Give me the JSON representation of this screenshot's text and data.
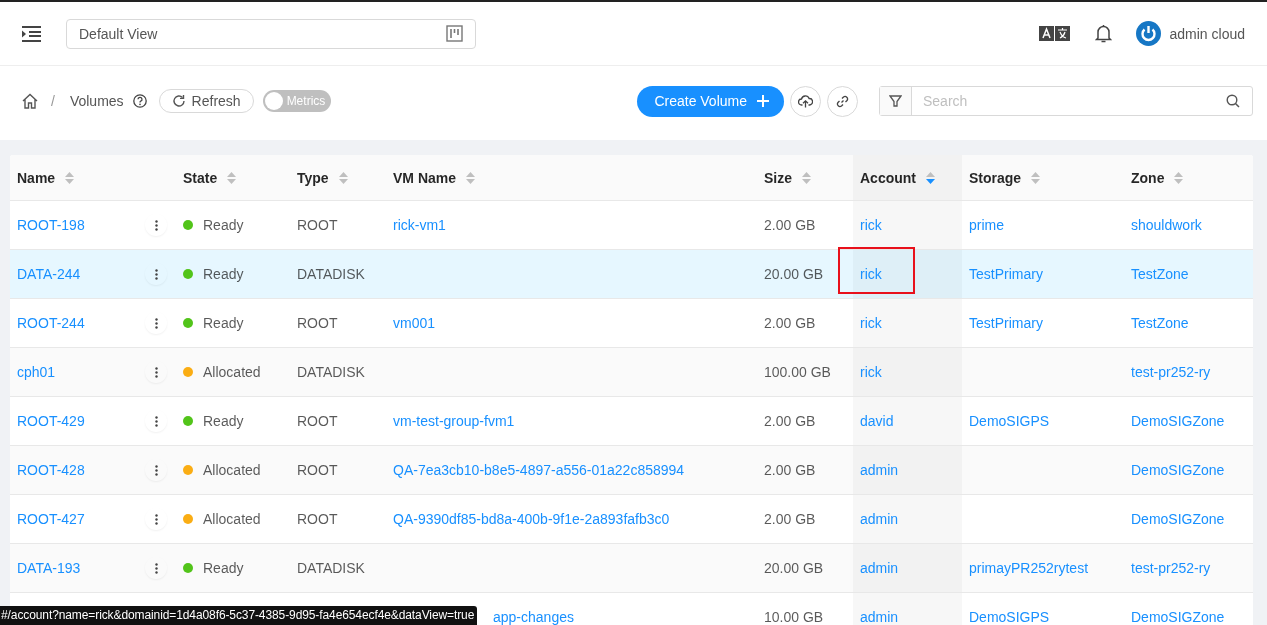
{
  "header": {
    "view_selector": {
      "value": "Default View"
    },
    "user": {
      "name": "admin cloud"
    }
  },
  "breadcrumb": {
    "separator": "/",
    "page": "Volumes"
  },
  "toolbar": {
    "refresh": "Refresh",
    "metrics": {
      "label": "Metrics",
      "on": false
    },
    "create": "Create Volume",
    "search": {
      "placeholder": "Search"
    }
  },
  "table": {
    "columns": [
      {
        "label": "Name",
        "sorted": false
      },
      {
        "label": "State",
        "sorted": false
      },
      {
        "label": "Type",
        "sorted": false
      },
      {
        "label": "VM Name",
        "sorted": false
      },
      {
        "label": "Size",
        "sorted": false
      },
      {
        "label": "Account",
        "sorted": true
      },
      {
        "label": "Storage",
        "sorted": false
      },
      {
        "label": "Zone",
        "sorted": false
      }
    ],
    "rows": [
      {
        "name": "ROOT-198",
        "state": "Ready",
        "color": "#52c41a",
        "type": "ROOT",
        "vm_name": "rick-vm1",
        "size": "2.00 GB",
        "account": "rick",
        "storage": "prime",
        "zone": "shouldwork",
        "hovered": false,
        "outlined": false
      },
      {
        "name": "DATA-244",
        "state": "Ready",
        "color": "#52c41a",
        "type": "DATADISK",
        "size": "20.00 GB",
        "account": "rick",
        "storage": "TestPrimary",
        "zone": "TestZone",
        "hovered": true,
        "outlined": true
      },
      {
        "name": "ROOT-244",
        "state": "Ready",
        "color": "#52c41a",
        "type": "ROOT",
        "vm_name": "vm001",
        "size": "2.00 GB",
        "account": "rick",
        "storage": "TestPrimary",
        "zone": "TestZone",
        "hovered": false,
        "outlined": false
      },
      {
        "name": "cph01",
        "state": "Allocated",
        "color": "#faad14",
        "type": "DATADISK",
        "size": "100.00 GB",
        "account": "rick",
        "zone": "test-pr252-ry",
        "hovered": false,
        "outlined": false
      },
      {
        "name": "ROOT-429",
        "state": "Ready",
        "color": "#52c41a",
        "type": "ROOT",
        "vm_name": "vm-test-group-fvm1",
        "size": "2.00 GB",
        "account": "david",
        "storage": "DemoSIGPS",
        "zone": "DemoSIGZone",
        "hovered": false,
        "outlined": false
      },
      {
        "name": "ROOT-428",
        "state": "Allocated",
        "color": "#faad14",
        "type": "ROOT",
        "vm_name": "QA-7ea3cb10-b8e5-4897-a556-01a22c858994",
        "size": "2.00 GB",
        "account": "admin",
        "zone": "DemoSIGZone",
        "hovered": false,
        "outlined": false
      },
      {
        "name": "ROOT-427",
        "state": "Allocated",
        "color": "#faad14",
        "type": "ROOT",
        "vm_name": "QA-9390df85-bd8a-400b-9f1e-2a893fafb3c0",
        "size": "2.00 GB",
        "account": "admin",
        "zone": "DemoSIGZone",
        "hovered": false,
        "outlined": false
      },
      {
        "name": "DATA-193",
        "state": "Ready",
        "color": "#52c41a",
        "type": "DATADISK",
        "size": "20.00 GB",
        "account": "admin",
        "storage": "primayPR252rytest",
        "zone": "test-pr252-ry",
        "hovered": false,
        "outlined": false
      },
      {
        "vm_name": "app-changes",
        "size": "10.00 GB",
        "account": "admin",
        "storage": "DemoSIGPS",
        "zone": "DemoSIGZone",
        "hovered": false,
        "outlined": false,
        "covered": true
      }
    ]
  },
  "link_tooltip": "#/account?name=rick&domainid=1d4a08f6-5c37-4385-9d95-fa4e654ecf4e&dataView=true"
}
